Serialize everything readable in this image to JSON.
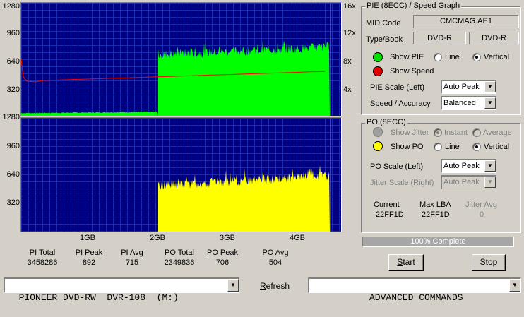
{
  "pie_graph": {
    "y_left": [
      "1280",
      "960",
      "640",
      "320"
    ],
    "y_right": [
      "16x",
      "12x",
      "8x",
      "4x"
    ],
    "colors": {
      "bg": "#000080",
      "grid": "#1a2ab0",
      "pie": "#00ff00",
      "speed": "#ff0000"
    }
  },
  "po_graph": {
    "y_left": [
      "1280",
      "960",
      "640",
      "320"
    ],
    "colors": {
      "bg": "#000080",
      "grid": "#1a2ab0",
      "po": "#ffff00"
    }
  },
  "x_axis": [
    "1GB",
    "2GB",
    "3GB",
    "4GB"
  ],
  "stats": {
    "headers": [
      "PI Total",
      "PI Peak",
      "PI Avg",
      "PO Total",
      "PO Peak",
      "PO Avg"
    ],
    "values": [
      "3458286",
      "892",
      "715",
      "2349836",
      "706",
      "504"
    ]
  },
  "pie_panel": {
    "title": "PIE (8ECC) / Speed Graph",
    "mid_code_label": "MID Code",
    "mid_code_value": "CMCMAG.AE1",
    "type_book_label": "Type/Book",
    "type_value": "DVD-R",
    "book_value": "DVD-R",
    "show_pie_label": "Show PIE",
    "line_label": "Line",
    "vertical_label": "Vertical",
    "show_speed_label": "Show Speed",
    "pie_scale_label": "PIE Scale (Left)",
    "pie_scale_value": "Auto Peak",
    "speed_accuracy_label": "Speed / Accuracy",
    "speed_accuracy_value": "Balanced"
  },
  "po_panel": {
    "title": "PO (8ECC)",
    "show_jitter_label": "Show Jitter",
    "instant_label": "Instant",
    "average_label": "Average",
    "show_po_label": "Show PO",
    "line_label": "Line",
    "vertical_label": "Vertical",
    "po_scale_label": "PO Scale (Left)",
    "po_scale_value": "Auto Peak",
    "jitter_scale_label": "Jitter Scale (Right)",
    "jitter_scale_value": "Auto Peak",
    "current_label": "Current",
    "current_value": "22FF1D",
    "max_lba_label": "Max LBA",
    "max_lba_value": "22FF1D",
    "jitter_avg_label": "Jitter Avg",
    "jitter_avg_value": "0"
  },
  "progress": {
    "label": "100% Complete",
    "fraction": 1.0
  },
  "buttons": {
    "start": "Start",
    "stop": "Stop"
  },
  "bottom": {
    "drive": "PIONEER DVD-RW  DVR-108  (M:)",
    "refresh": "Refresh",
    "commands": "ADVANCED COMMANDS"
  }
}
